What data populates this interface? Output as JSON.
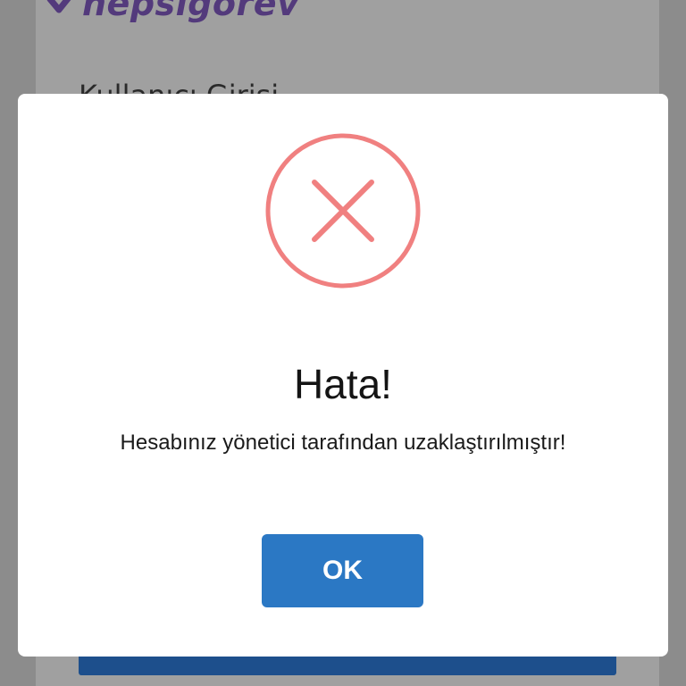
{
  "background": {
    "logo_text": "hepsigorev",
    "heading": "Kullanıcı Girişi",
    "brand_color": "#533a7c",
    "primary_button_color": "#1d4f8c"
  },
  "dialog": {
    "icon": "error-x-circle-icon",
    "icon_color": "#f08080",
    "title": "Hata!",
    "message": "Hesabınız yönetici tarafından uzaklaştırılmıştır!",
    "ok_label": "OK",
    "ok_color": "#2b78c4"
  }
}
